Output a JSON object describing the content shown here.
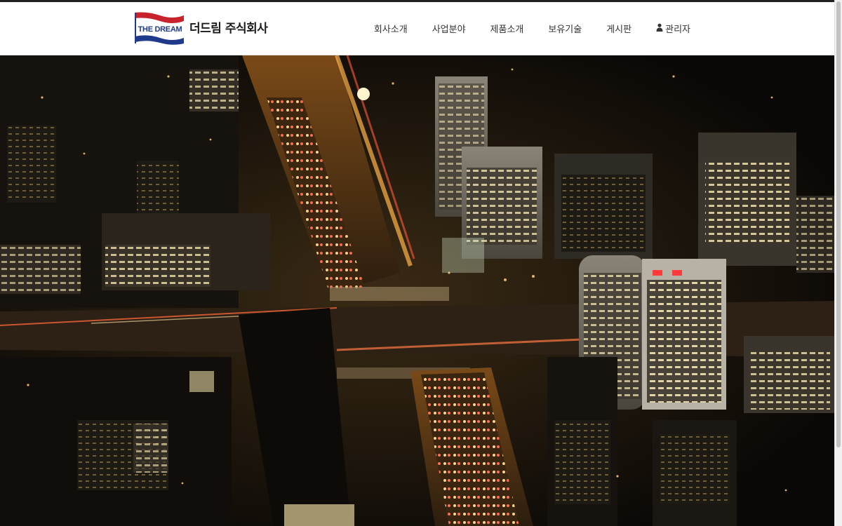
{
  "brand": {
    "logo_text": "THE DREAM",
    "company_name": "더드림 주식회사",
    "flag_colors": {
      "top": "#c8232c",
      "bottom": "#1f3a8a",
      "text": "#1f3a8a"
    }
  },
  "nav": {
    "items": [
      {
        "label": "회사소개"
      },
      {
        "label": "사업분야"
      },
      {
        "label": "제품소개"
      },
      {
        "label": "보유기술"
      },
      {
        "label": "게시판"
      }
    ],
    "admin": {
      "label": "관리자",
      "icon": "user-icon"
    }
  },
  "hero": {
    "description_icon": "night-city-aerial-image"
  },
  "colors": {
    "header_bg": "#ffffff",
    "nav_text": "#333333",
    "accent_lights": "#f2a23a"
  }
}
